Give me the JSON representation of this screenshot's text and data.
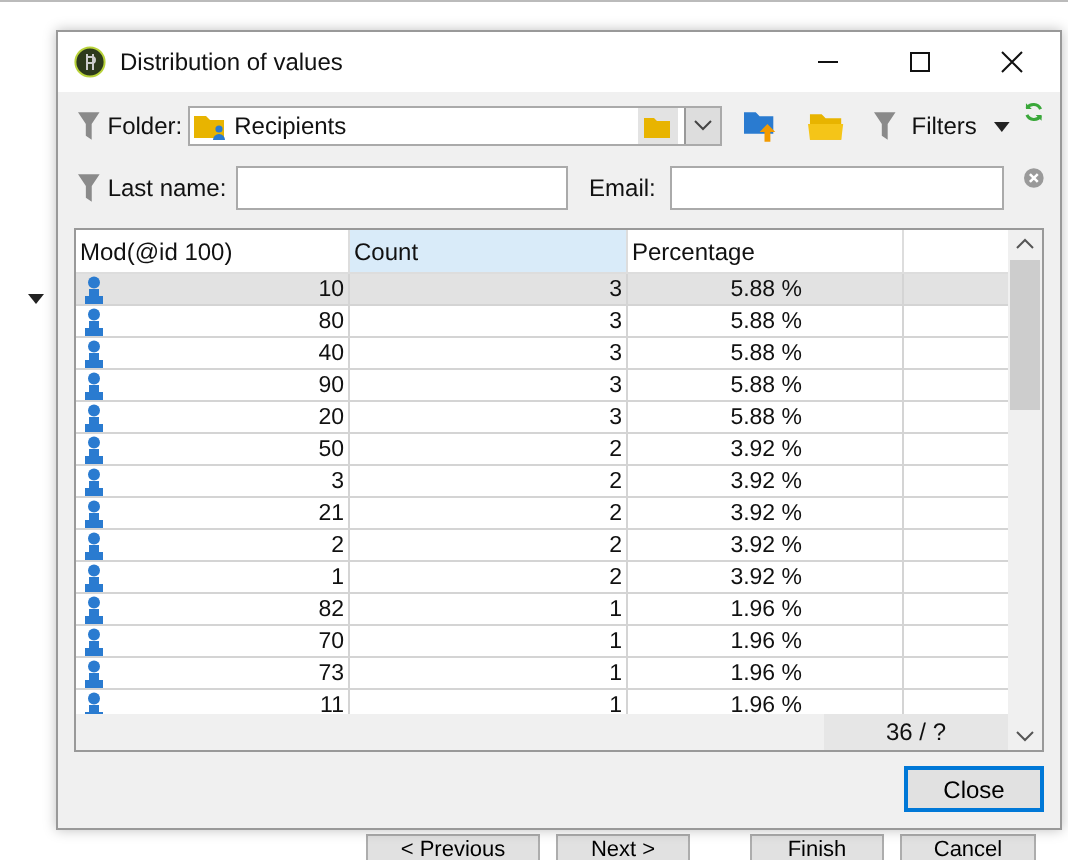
{
  "window": {
    "title": "Distribution of values"
  },
  "toolbar": {
    "folder_label": "Folder:",
    "folder_value": "Recipients",
    "filters_label": "Filters"
  },
  "filters": {
    "last_name_label": "Last name:",
    "email_label": "Email:"
  },
  "table": {
    "columns": [
      {
        "label": "Mod(@id 100)",
        "sorted": false
      },
      {
        "label": "Count",
        "sorted": true
      },
      {
        "label": "Percentage",
        "sorted": false
      }
    ],
    "rows": [
      {
        "mod": "10",
        "count": "3",
        "percentage": "5.88 %",
        "selected": true
      },
      {
        "mod": "80",
        "count": "3",
        "percentage": "5.88 %",
        "selected": false
      },
      {
        "mod": "40",
        "count": "3",
        "percentage": "5.88 %",
        "selected": false
      },
      {
        "mod": "90",
        "count": "3",
        "percentage": "5.88 %",
        "selected": false
      },
      {
        "mod": "20",
        "count": "3",
        "percentage": "5.88 %",
        "selected": false
      },
      {
        "mod": "50",
        "count": "2",
        "percentage": "3.92 %",
        "selected": false
      },
      {
        "mod": "3",
        "count": "2",
        "percentage": "3.92 %",
        "selected": false
      },
      {
        "mod": "21",
        "count": "2",
        "percentage": "3.92 %",
        "selected": false
      },
      {
        "mod": "2",
        "count": "2",
        "percentage": "3.92 %",
        "selected": false
      },
      {
        "mod": "1",
        "count": "2",
        "percentage": "3.92 %",
        "selected": false
      },
      {
        "mod": "82",
        "count": "1",
        "percentage": "1.96 %",
        "selected": false
      },
      {
        "mod": "70",
        "count": "1",
        "percentage": "1.96 %",
        "selected": false
      },
      {
        "mod": "73",
        "count": "1",
        "percentage": "1.96 %",
        "selected": false
      },
      {
        "mod": "11",
        "count": "1",
        "percentage": "1.96 %",
        "selected": false
      }
    ],
    "record_count": "36 / ?"
  },
  "close_button": "Close",
  "background_buttons": [
    "< Previous",
    "Next >",
    "Finish",
    "Cancel"
  ]
}
